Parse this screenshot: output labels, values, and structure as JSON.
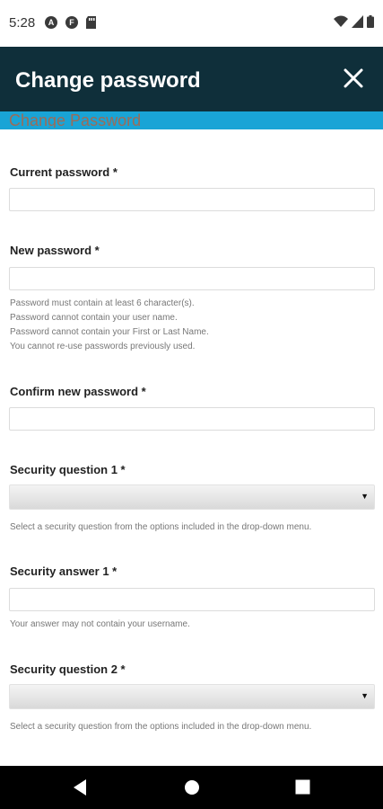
{
  "status_bar": {
    "time": "5:28",
    "icons": [
      "a-circle-icon",
      "f-circle-icon",
      "sd-card-icon",
      "wifi-icon",
      "cell-signal-icon",
      "battery-icon"
    ],
    "letter_icons": [
      "A",
      "F"
    ]
  },
  "header": {
    "title": "Change password",
    "close_icon": "close-icon",
    "background": "#0f2f3a"
  },
  "strip": {
    "title": "Change Password",
    "color": "#19a4d6"
  },
  "form": {
    "current_password": {
      "label": "Current password *",
      "value": ""
    },
    "new_password": {
      "label": "New password *",
      "value": "",
      "help": [
        "Password must contain at least 6 character(s).",
        "Password cannot contain your user name.",
        "Password cannot contain your First or Last Name.",
        "You cannot re-use passwords previously used."
      ]
    },
    "confirm_password": {
      "label": "Confirm new password *",
      "value": ""
    },
    "security_question_1": {
      "label": "Security question 1 *",
      "value": "",
      "help": "Select a security question from the options included in the drop-down menu."
    },
    "security_answer_1": {
      "label": "Security answer 1 *",
      "value": "",
      "help": "Your answer may not contain your username."
    },
    "security_question_2": {
      "label": "Security question 2 *",
      "value": "",
      "help": "Select a security question from the options included in the drop-down menu."
    }
  },
  "nav_bar": {
    "buttons": [
      "back-icon",
      "home-icon",
      "recents-icon"
    ]
  }
}
